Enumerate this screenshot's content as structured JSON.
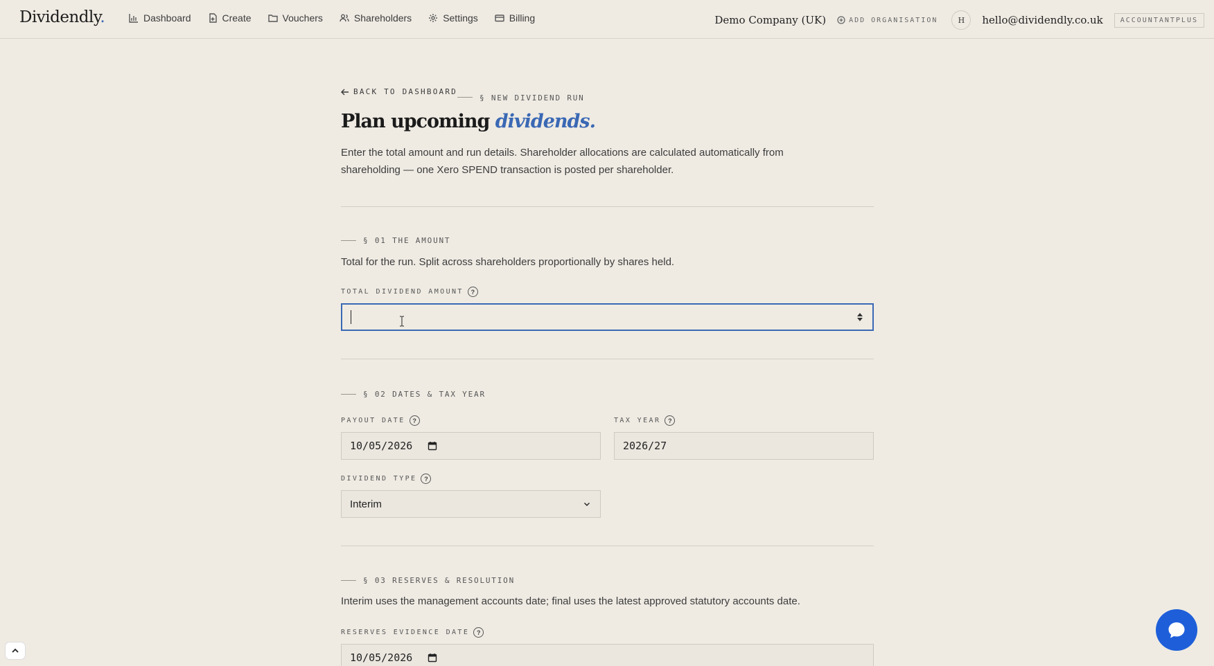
{
  "brand": {
    "name": "Dividendly",
    "dot": ".",
    "dot_color": "#3a68b4"
  },
  "nav": [
    {
      "label": "Dashboard",
      "icon": "bar-chart-icon"
    },
    {
      "label": "Create",
      "icon": "document-plus-icon"
    },
    {
      "label": "Vouchers",
      "icon": "folder-icon"
    },
    {
      "label": "Shareholders",
      "icon": "users-icon"
    },
    {
      "label": "Settings",
      "icon": "gear-icon"
    },
    {
      "label": "Billing",
      "icon": "credit-card-icon"
    }
  ],
  "account": {
    "organisation": "Demo Company (UK)",
    "add_organisation": "ADD ORGANISATION",
    "avatar_initial": "H",
    "email": "hello@dividendly.co.uk",
    "plan": "ACCOUNTANTPLUS"
  },
  "page": {
    "back_link": "BACK TO DASHBOARD",
    "crumb": "§ NEW DIVIDEND RUN",
    "title_main": "Plan upcoming ",
    "title_accent": "dividends.",
    "accent_color": "#3a68b4",
    "intro": "Enter the total amount and run details. Shareholder allocations are calculated automatically from shareholding — one Xero SPEND transaction is posted per shareholder."
  },
  "sections": {
    "amount": {
      "label": "§ 01 THE AMOUNT",
      "desc": "Total for the run. Split across shareholders proportionally by shares held.",
      "total_label": "TOTAL DIVIDEND AMOUNT",
      "total_value": ""
    },
    "dates": {
      "label": "§ 02 DATES & TAX YEAR",
      "payout_label": "PAYOUT DATE",
      "payout_value": "10/05/2026",
      "tax_year_label": "TAX YEAR",
      "tax_year_value": "2026/27",
      "type_label": "DIVIDEND TYPE",
      "type_value": "Interim"
    },
    "reserves": {
      "label": "§ 03 RESERVES & RESOLUTION",
      "desc": "Interim uses the management accounts date; final uses the latest approved statutory accounts date.",
      "evidence_label": "RESERVES EVIDENCE DATE",
      "evidence_value": "10/05/2026"
    }
  },
  "help_glyph": "?",
  "chat_color": "#1e5fd9"
}
